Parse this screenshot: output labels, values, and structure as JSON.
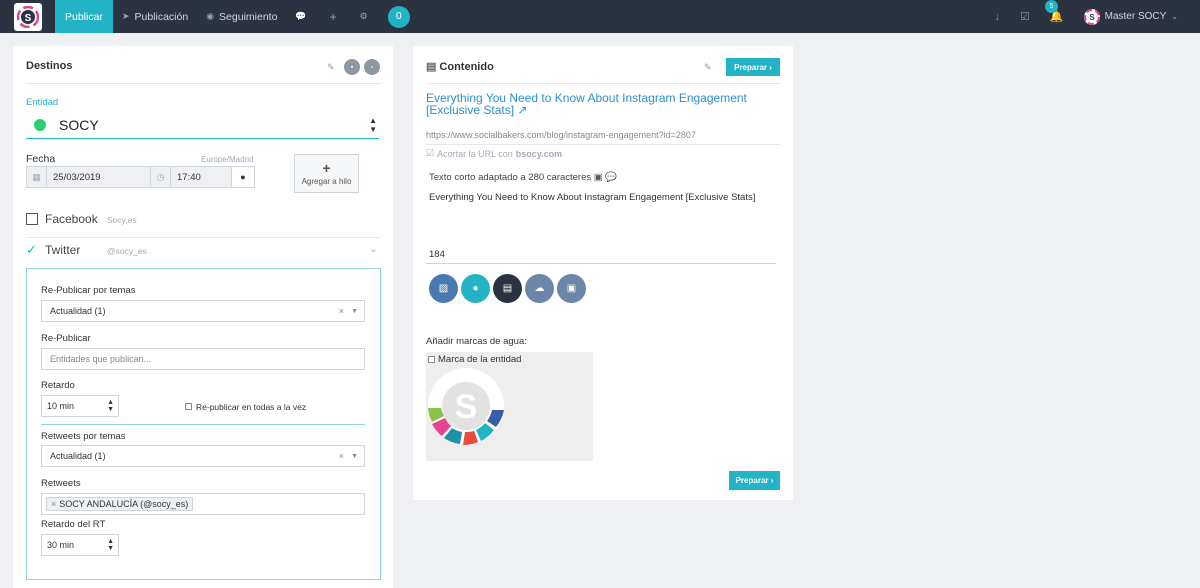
{
  "nav": {
    "publicar": "Publicar",
    "publicacion": "Publicación",
    "seguimiento": "Seguimiento",
    "count_badge": "0",
    "notif_badge": "5",
    "user": "Master SOCY"
  },
  "left": {
    "title": "Destinos",
    "entidad_label": "Entidad",
    "entity_name": "SOCY",
    "fecha_label": "Fecha",
    "timezone": "Europe/Madrid",
    "date": "25/03/2019",
    "time": "17:40",
    "add_thread": "Agregar a hilo",
    "facebook": {
      "label": "Facebook",
      "handle": "Socy.es"
    },
    "twitter": {
      "label": "Twitter",
      "handle": "@socy_es"
    },
    "repub_temas_label": "Re-Publicar por temas",
    "repub_temas_value": "Actualidad (1)",
    "repub_label": "Re-Publicar",
    "repub_placeholder": "Entidades que publican...",
    "retardo_label": "Retardo",
    "retardo_value": "10 min",
    "repub_all": "Re-publicar en todas a la vez",
    "rt_temas_label": "Retweets por temas",
    "rt_temas_value": "Actualidad (1)",
    "rt_label": "Retweets",
    "rt_tag": "SOCY ANDALUCÍA (@socy_es)",
    "rt_delay_label": "Retardo del RT",
    "rt_delay_value": "30 min"
  },
  "right": {
    "title": "Contenido",
    "prep_button": "Preparar ›",
    "link_title": "Everything You Need to Know About Instagram Engagement [Exclusive Stats]",
    "url": "https://www.socialbakers.com/blog/instagram-engagement?id=2807",
    "short_prefix": "Acortar la URL con",
    "short_domain": "bsocy.com",
    "text_label": "Texto corto adaptado a 280 caracteres",
    "text_body": "Everything You Need to Know About Instagram Engagement [Exclusive Stats]",
    "char_count": "184",
    "watermark_label": "Añadir marcas de agua:",
    "watermark_option": "Marca de la entidad",
    "prep_button_bottom": "Preparar ›"
  },
  "colors": {
    "accent": "#22b3c6",
    "navbar": "#2b3340",
    "link": "#2b8fd6",
    "entity_dot": "#2ecc71"
  }
}
